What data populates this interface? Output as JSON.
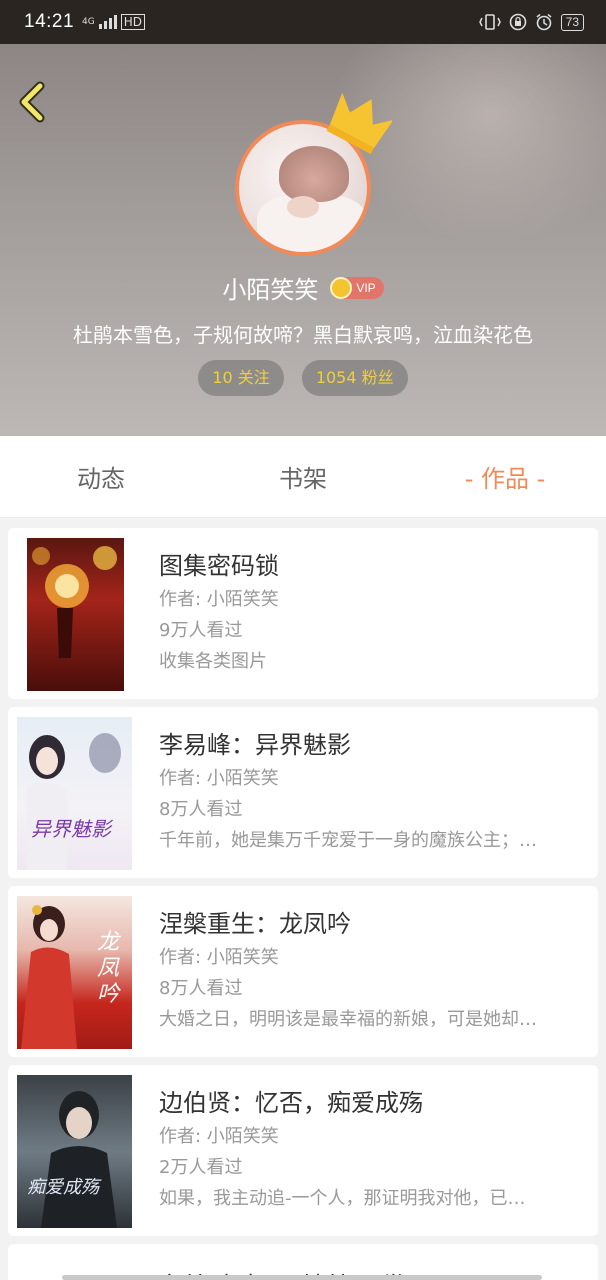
{
  "status_bar": {
    "time": "14:21",
    "network": "4G",
    "hd": "HD",
    "battery": "73"
  },
  "profile": {
    "username": "小陌笑笑",
    "vip_label": "VIP",
    "bio": "杜鹃本雪色，子规何故啼？黑白默哀鸣，泣血染花色",
    "following": "10 关注",
    "followers": "1054 粉丝",
    "accent_color": "#f28a58"
  },
  "tabs": [
    {
      "label": "动态",
      "active": false
    },
    {
      "label": "书架",
      "active": false
    },
    {
      "label": "- 作品 -",
      "active": true
    }
  ],
  "works": [
    {
      "title": "图集密码锁",
      "author": "作者: 小陌笑笑",
      "views": "9万人看过",
      "summary": "收集各类图片"
    },
    {
      "title": "李易峰：异界魅影",
      "author": "作者: 小陌笑笑",
      "views": "8万人看过",
      "summary": "千年前，她是集万千宠爱于一身的魔族公主；…",
      "cover_text": "异界魅影"
    },
    {
      "title": "涅槃重生：龙凤吟",
      "author": "作者: 小陌笑笑",
      "views": "8万人看过",
      "summary": "大婚之日，明明该是最幸福的新娘，可是她却…",
      "cover_text": "龙凤吟"
    },
    {
      "title": "边伯贤：忆否，痴爱成殇",
      "author": "作者: 小陌笑笑",
      "views": "2万人看过",
      "summary": "如果，我主动追-一个人，那证明我对他，已…",
      "cover_text": "痴爱成殇"
    },
    {
      "title": "牟某 東大 一 地某一 世"
    }
  ]
}
